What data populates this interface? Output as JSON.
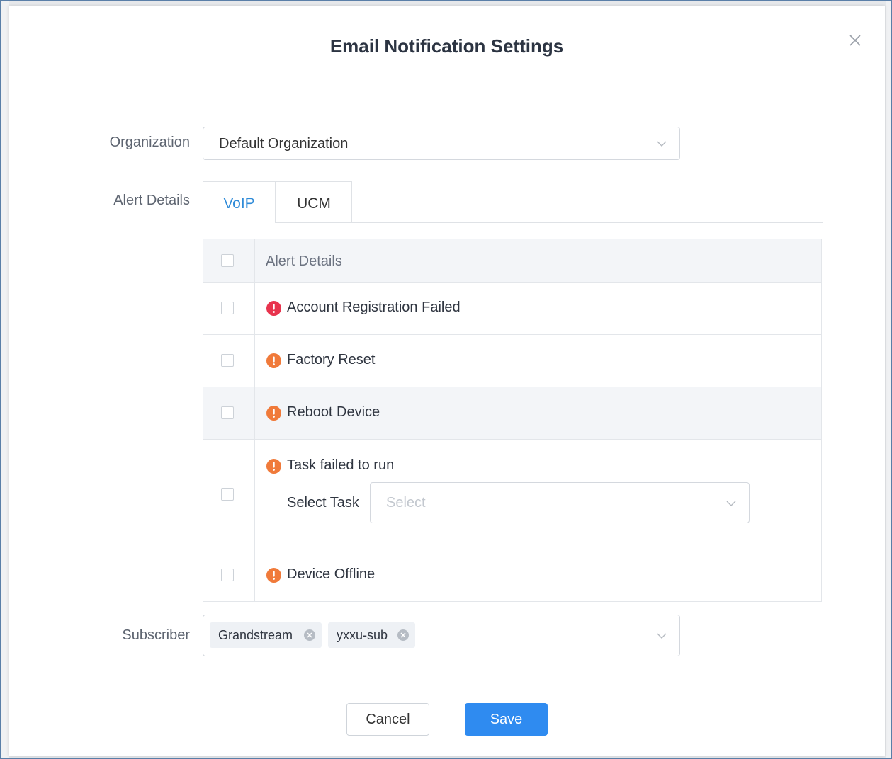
{
  "dialog": {
    "title": "Email Notification Settings"
  },
  "organization": {
    "label": "Organization",
    "value": "Default Organization"
  },
  "alert_details": {
    "label": "Alert Details",
    "tabs": [
      {
        "label": "VoIP",
        "active": true
      },
      {
        "label": "UCM",
        "active": false
      }
    ],
    "table_header": "Alert Details",
    "items": [
      {
        "label": "Account Registration Failed",
        "severity": "critical",
        "icon_color": "#e8344e"
      },
      {
        "label": "Factory Reset",
        "severity": "warning",
        "icon_color": "#f07a3a"
      },
      {
        "label": "Reboot Device",
        "severity": "warning",
        "icon_color": "#f07a3a"
      },
      {
        "label": "Task failed to run",
        "severity": "warning",
        "icon_color": "#f07a3a"
      },
      {
        "label": "Device Offline",
        "severity": "warning",
        "icon_color": "#f07a3a"
      }
    ],
    "select_task": {
      "label": "Select Task",
      "placeholder": "Select"
    }
  },
  "subscriber": {
    "label": "Subscriber",
    "tags": [
      "Grandstream",
      "yxxu-sub"
    ]
  },
  "buttons": {
    "cancel": "Cancel",
    "save": "Save"
  },
  "colors": {
    "accent": "#2f8bf0",
    "tab_active": "#2f8bd8",
    "critical": "#e8344e",
    "warning": "#f07a3a"
  }
}
